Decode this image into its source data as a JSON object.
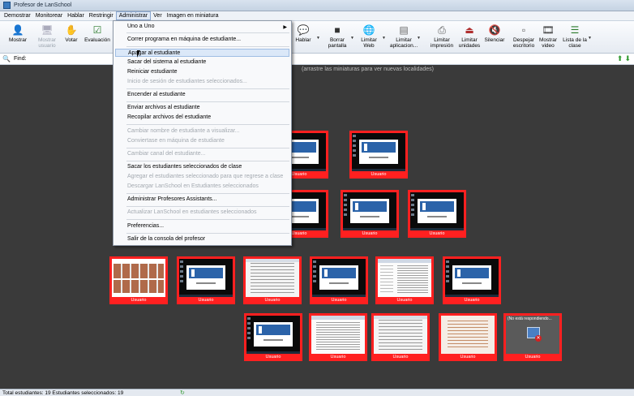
{
  "window": {
    "title": "Profesor de LanSchool"
  },
  "menubar": [
    {
      "id": "demostrar",
      "label": "Demostrar"
    },
    {
      "id": "monitorear",
      "label": "Monitorear"
    },
    {
      "id": "hablar",
      "label": "Hablar"
    },
    {
      "id": "restringir",
      "label": "Restringir"
    },
    {
      "id": "administrar",
      "label": "Administrar",
      "active": true
    },
    {
      "id": "ver",
      "label": "Ver"
    },
    {
      "id": "imagen",
      "label": "Imagen en miniatura"
    }
  ],
  "toolbar": {
    "mostrar": {
      "label": "Mostrar",
      "icon": "presenter-icon"
    },
    "mostrar_usuario": {
      "label": "Mostrar usuario",
      "icon": "user-screen-icon",
      "disabled": true
    },
    "votar": {
      "label": "Votar",
      "icon": "vote-icon"
    },
    "evaluacion": {
      "label": "Evaluación",
      "icon": "test-icon"
    },
    "hablar": {
      "label": "Hablar",
      "icon": "chat-icon"
    },
    "borrar": {
      "label": "Borrar pantalla",
      "icon": "blank-screen-icon"
    },
    "limitar_web": {
      "label": "Limitar Web",
      "icon": "web-limit-icon"
    },
    "limitar_apps": {
      "label": "Limitar aplicacion...",
      "icon": "app-limit-icon"
    },
    "limitar_impresion": {
      "label": "Limitar impresión",
      "icon": "printer-limit-icon"
    },
    "limitar_unidades": {
      "label": "Limitar unidades",
      "icon": "drive-limit-icon"
    },
    "silenciar": {
      "label": "Silenciar",
      "icon": "mute-icon"
    },
    "despejar": {
      "label": "Despejar escritorio",
      "icon": "clear-desktop-icon"
    },
    "mostrar_video": {
      "label": "Mostrar video",
      "icon": "video-icon"
    },
    "lista": {
      "label": "Lista de la clase",
      "icon": "class-list-icon"
    }
  },
  "findbar": {
    "label": "Find:"
  },
  "workspace": {
    "hint": "(arrastre las miniaturas para ver nuevas localidades)"
  },
  "thumbnails": {
    "caption": "Usuario",
    "hung_message": "(No está respondiendo..."
  },
  "dropdown": {
    "items": [
      {
        "label": "Uno a Uno",
        "has_submenu": true
      },
      {
        "label": "Correr programa en máquina de estudiante..."
      },
      {
        "label": "Apagar al estudiante",
        "hover": true
      },
      {
        "label": "Sacar del sistema al estudiante"
      },
      {
        "label": "Reiniciar estudiante"
      },
      {
        "label": "Inicio de sesión de estudiantes seleccionados...",
        "disabled": true
      },
      {
        "label": "Encender al estudiante"
      },
      {
        "label": "Enviar archivos al estudiante"
      },
      {
        "label": "Recopilar archivos del estudiante"
      },
      {
        "label": "Cambiar nombre de estudiante a visualizar...",
        "disabled": true
      },
      {
        "label": "Conviertase en máquina de estudiante",
        "disabled": true
      },
      {
        "label": "Cambiar canal del estudiante...",
        "disabled": true
      },
      {
        "label": "Sacar los estudiantes seleccionados de clase"
      },
      {
        "label": "Agregar el estudiantes seleccionado para que regrese a clase",
        "disabled": true
      },
      {
        "label": "Descargar LanSchool en Estudiantes seleccionados",
        "disabled": true
      },
      {
        "label": "Administrar Profesores Assistants..."
      },
      {
        "label": "Actualizar LanSchool en estudiantes seleccionados",
        "disabled": true
      },
      {
        "label": "Preferencias..."
      },
      {
        "label": "Salir de la consola del profesor"
      }
    ]
  },
  "status": {
    "text": "Total estudiantes: 19   Estudiantes seleccionados: 19"
  },
  "colors": {
    "selection_border": "#ff2020",
    "workspace_bg": "#3a3a3a"
  }
}
